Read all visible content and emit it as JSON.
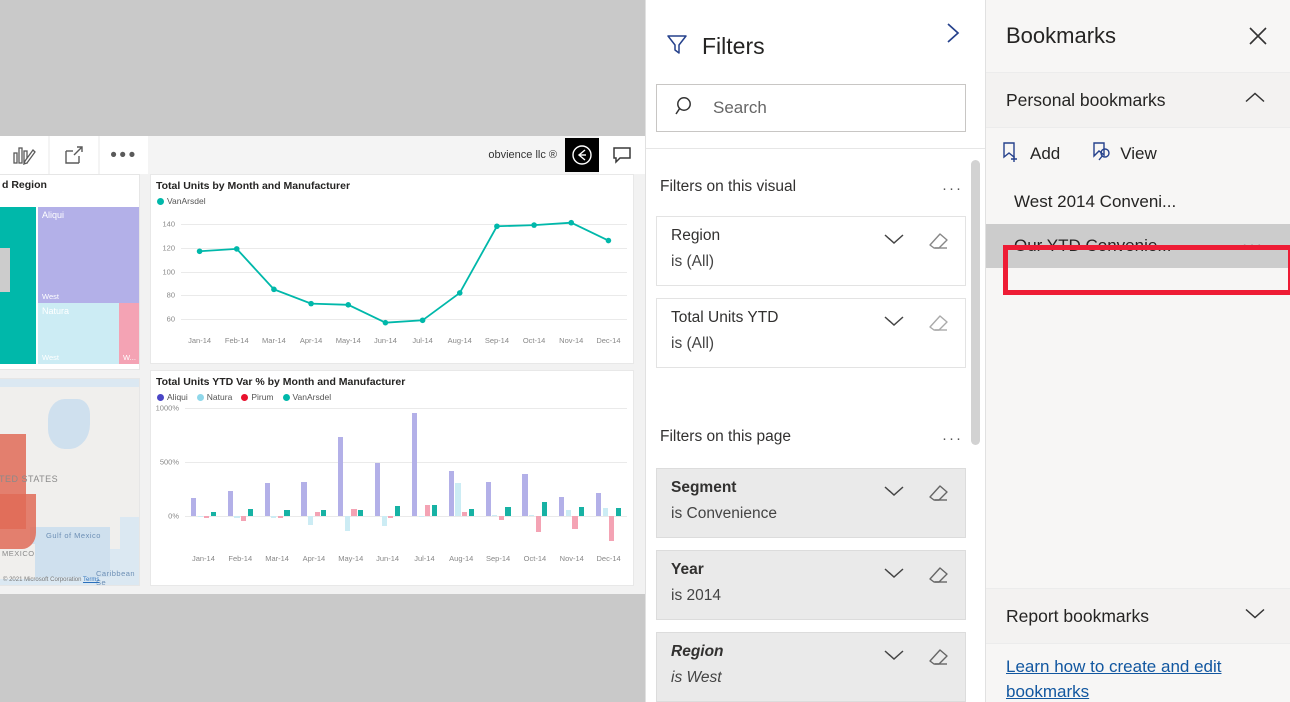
{
  "report": {
    "visual_toolbar": {
      "edit_icon": "edit-visual-icon",
      "focus_icon": "focus-mode-icon",
      "more_label": "•••",
      "brand": "obvience llc ®",
      "badge_icon": "rotate-arrow-icon",
      "comment_icon": "comment-icon"
    },
    "treemap": {
      "title": "d Region",
      "cells": [
        {
          "label": "Aliqui",
          "sub": "West",
          "color": "#b3b0e8"
        },
        {
          "label": "Natura",
          "sub": "West",
          "color": "#ccecf4"
        },
        {
          "label": "W...",
          "sub": "",
          "color": "#f4a3b4"
        }
      ],
      "left_block_color": "#00b8aa"
    },
    "map": {
      "country_label": "ITED STATES",
      "mexico_label": "MEXICO",
      "gulf_label": "Gulf of Mexico",
      "caribbean_label": "Caribbean Se",
      "attribution": "© 2021 Microsoft Corporation",
      "attribution_link": "Terms",
      "highlight_color": "#e06b57"
    }
  },
  "chart_data": [
    {
      "type": "line",
      "title": "Total Units by Month and Manufacturer",
      "legend": [
        {
          "name": "VanArsdel",
          "color": "#00b8aa"
        }
      ],
      "legend_position": "top-left",
      "categories": [
        "Jan-14",
        "Feb-14",
        "Mar-14",
        "Apr-14",
        "May-14",
        "Jun-14",
        "Jul-14",
        "Aug-14",
        "Sep-14",
        "Oct-14",
        "Nov-14",
        "Dec-14"
      ],
      "series": [
        {
          "name": "VanArsdel",
          "values": [
            117,
            119,
            85,
            73,
            72,
            57,
            59,
            82,
            138,
            139,
            141,
            126
          ]
        }
      ],
      "yticks": [
        60,
        80,
        100,
        120,
        140
      ],
      "ylim": [
        50,
        150
      ],
      "xlabel": "",
      "ylabel": "",
      "grid": true
    },
    {
      "type": "bar",
      "title": "Total Units YTD Var % by Month and Manufacturer",
      "legend": [
        {
          "name": "Aliqui",
          "color": "#4a46c6"
        },
        {
          "name": "Natura",
          "color": "#8fd7ea"
        },
        {
          "name": "Pirum",
          "color": "#e8112d"
        },
        {
          "name": "VanArsdel",
          "color": "#00b8aa"
        }
      ],
      "legend_position": "top-left",
      "categories": [
        "Jan-14",
        "Feb-14",
        "Mar-14",
        "Apr-14",
        "May-14",
        "Jun-14",
        "Jul-14",
        "Aug-14",
        "Sep-14",
        "Oct-14",
        "Nov-14",
        "Dec-14"
      ],
      "series": [
        {
          "name": "Aliqui",
          "color": "#b3b0e8",
          "values": [
            165,
            230,
            300,
            315,
            730,
            490,
            955,
            415,
            310,
            390,
            175,
            215
          ]
        },
        {
          "name": "Natura",
          "color": "#ccecf4",
          "values": [
            0,
            -20,
            -20,
            -85,
            -140,
            -95,
            -15,
            300,
            5,
            5,
            50,
            75
          ]
        },
        {
          "name": "Pirum",
          "color": "#f4a3b4",
          "values": [
            -25,
            -50,
            -25,
            35,
            65,
            -20,
            100,
            35,
            -40,
            -155,
            -120,
            -235
          ]
        },
        {
          "name": "VanArsdel",
          "color": "#17b2a4",
          "values": [
            30,
            60,
            50,
            50,
            55,
            90,
            100,
            65,
            80,
            130,
            80,
            70
          ]
        }
      ],
      "yticks": [
        "0%",
        "500%",
        "1000%"
      ],
      "ylim": [
        -300,
        1000
      ],
      "xlabel": "",
      "ylabel": "",
      "grid": true
    }
  ],
  "filters": {
    "header_title": "Filters",
    "filter_icon": "funnel-icon",
    "expand_icon": "chevron-right-icon",
    "search": {
      "placeholder": "Search",
      "value": "",
      "icon": "search-icon"
    },
    "visual_section": {
      "label": "Filters on this visual",
      "menu": "···"
    },
    "page_section": {
      "label": "Filters on this page",
      "menu": "···"
    },
    "visual_filters": [
      {
        "name": "Region",
        "value": "is (All)",
        "bold": false,
        "italic": false
      },
      {
        "name": "Total Units YTD",
        "value": "is (All)",
        "bold": false,
        "italic": false
      }
    ],
    "page_filters": [
      {
        "name": "Segment",
        "value": "is Convenience",
        "bold": true,
        "italic": false
      },
      {
        "name": "Year",
        "value": "is 2014",
        "bold": true,
        "italic": false
      },
      {
        "name": "Region",
        "value": "is West",
        "bold": true,
        "italic": true
      }
    ],
    "chevron_icon": "chevron-down-icon",
    "erase_icon": "eraser-icon"
  },
  "bookmarks": {
    "title": "Bookmarks",
    "close_icon": "close-icon",
    "personal": {
      "label": "Personal bookmarks",
      "chevron": "chevron-up-icon",
      "actions": [
        {
          "label": "Add",
          "icon": "bookmark-add-icon"
        },
        {
          "label": "View",
          "icon": "bookmark-view-icon"
        }
      ],
      "items": [
        {
          "label": "West 2014 Conveni...",
          "selected": false,
          "menu": ""
        },
        {
          "label": "Our YTD Convenie...",
          "selected": true,
          "menu": "···"
        }
      ]
    },
    "report": {
      "label": "Report bookmarks",
      "chevron": "chevron-down-icon"
    },
    "help_link": "Learn how to create and edit bookmarks",
    "highlight_color": "#ee1c35"
  }
}
